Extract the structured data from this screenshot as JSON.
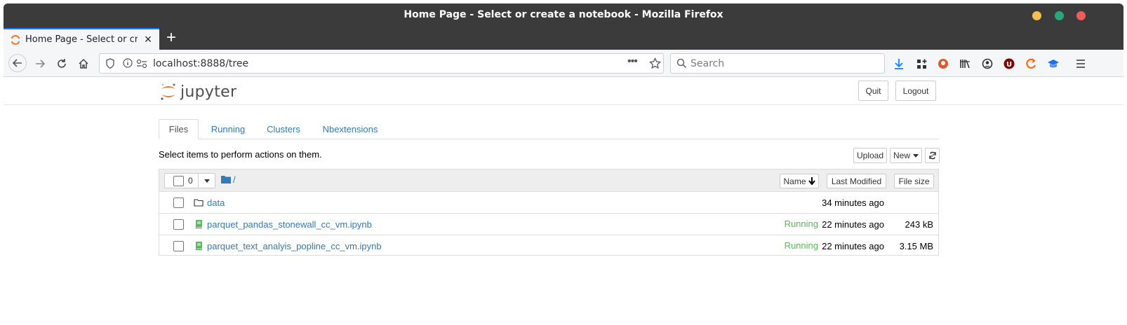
{
  "window": {
    "title": "Home Page - Select or create a notebook - Mozilla Firefox",
    "controls": {
      "minimize_color": "#f4bf4f",
      "maximize_color": "#27a87a",
      "close_color": "#ec5e5e"
    }
  },
  "browser": {
    "tab_title": "Home Page - Select or create a notebook",
    "new_tab_label": "+",
    "url": "localhost:8888/tree",
    "search_placeholder": "Search",
    "accent_color": "#0a84ff"
  },
  "jupyter": {
    "logo_text": "jupyter",
    "quit_label": "Quit",
    "logout_label": "Logout",
    "tabs": [
      {
        "label": "Files"
      },
      {
        "label": "Running"
      },
      {
        "label": "Clusters"
      },
      {
        "label": "Nbextensions"
      }
    ],
    "hint": "Select items to perform actions on them.",
    "upload_label": "Upload",
    "new_label": "New",
    "selected_count": "0",
    "breadcrumb": "/",
    "columns": {
      "name": "Name",
      "modified": "Last Modified",
      "size": "File size"
    },
    "items": [
      {
        "name": "data",
        "type": "folder",
        "status": "",
        "modified": "34 minutes ago",
        "size": ""
      },
      {
        "name": "parquet_pandas_stonewall_cc_vm.ipynb",
        "type": "notebook",
        "status": "Running",
        "modified": "22 minutes ago",
        "size": "243 kB"
      },
      {
        "name": "parquet_text_analyis_popline_cc_vm.ipynb",
        "type": "notebook",
        "status": "Running",
        "modified": "22 minutes ago",
        "size": "3.15 MB"
      }
    ],
    "link_color": "#337ab7",
    "running_color": "#5cb85c"
  }
}
